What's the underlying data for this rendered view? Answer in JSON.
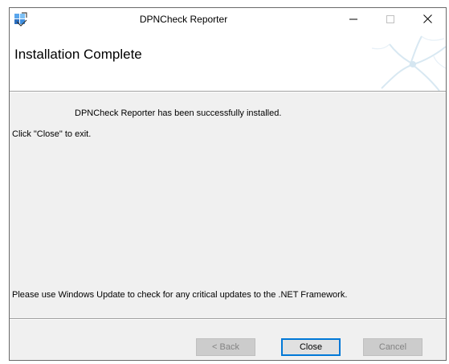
{
  "window": {
    "title": "DPNCheck Reporter",
    "controls": {
      "minimize_icon": "minimize-icon",
      "maximize_icon": "maximize-icon",
      "close_icon": "close-icon"
    }
  },
  "banner": {
    "title": "Installation Complete"
  },
  "content": {
    "installed_message": "DPNCheck Reporter has been successfully installed.",
    "exit_instruction": "Click \"Close\" to exit.",
    "update_notice": "Please use Windows Update to check for any critical updates to the .NET Framework."
  },
  "buttons": {
    "back_label": "< Back",
    "close_label": "Close",
    "cancel_label": "Cancel"
  },
  "colors": {
    "accent": "#0078d7",
    "dialog_background": "#f0f0f0",
    "disabled_text": "#838383"
  }
}
